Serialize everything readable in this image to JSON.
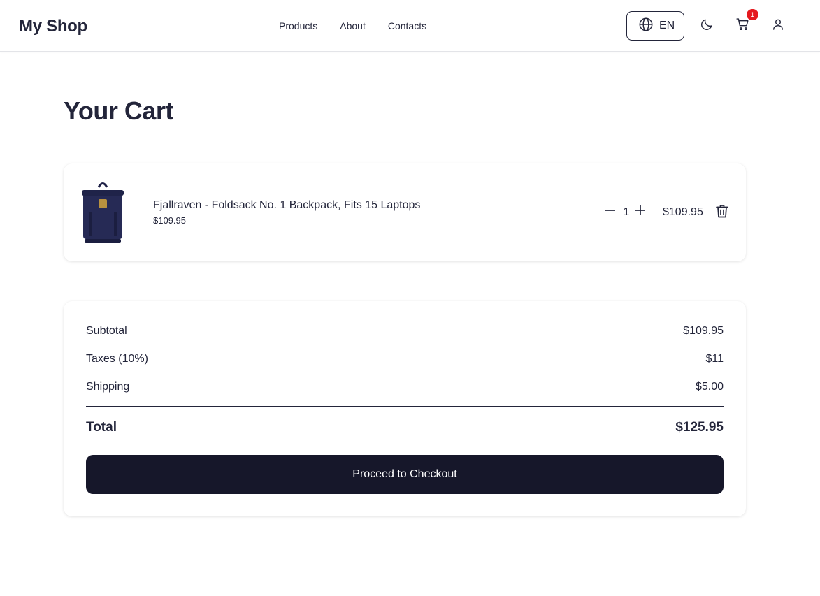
{
  "header": {
    "logo": "My Shop",
    "nav": [
      "Products",
      "About",
      "Contacts"
    ],
    "language": "EN",
    "cart_count": "1",
    "icons": {
      "language": "globe-icon",
      "theme": "moon-icon",
      "cart": "cart-icon",
      "user": "user-icon"
    }
  },
  "page": {
    "title": "Your Cart"
  },
  "cart": {
    "items": [
      {
        "name": "Fjallraven - Foldsack No. 1 Backpack, Fits 15 Laptops",
        "unit_price": "$109.95",
        "quantity": "1",
        "line_total": "$109.95"
      }
    ]
  },
  "summary": {
    "subtotal_label": "Subtotal",
    "subtotal_value": "$109.95",
    "taxes_label": "Taxes (10%)",
    "taxes_value": "$11",
    "shipping_label": "Shipping",
    "shipping_value": "$5.00",
    "total_label": "Total",
    "total_value": "$125.95",
    "checkout_label": "Proceed to Checkout"
  },
  "colors": {
    "primary": "#16172a",
    "text": "#23253a",
    "badge": "#e5191e",
    "product": "#262a55"
  }
}
